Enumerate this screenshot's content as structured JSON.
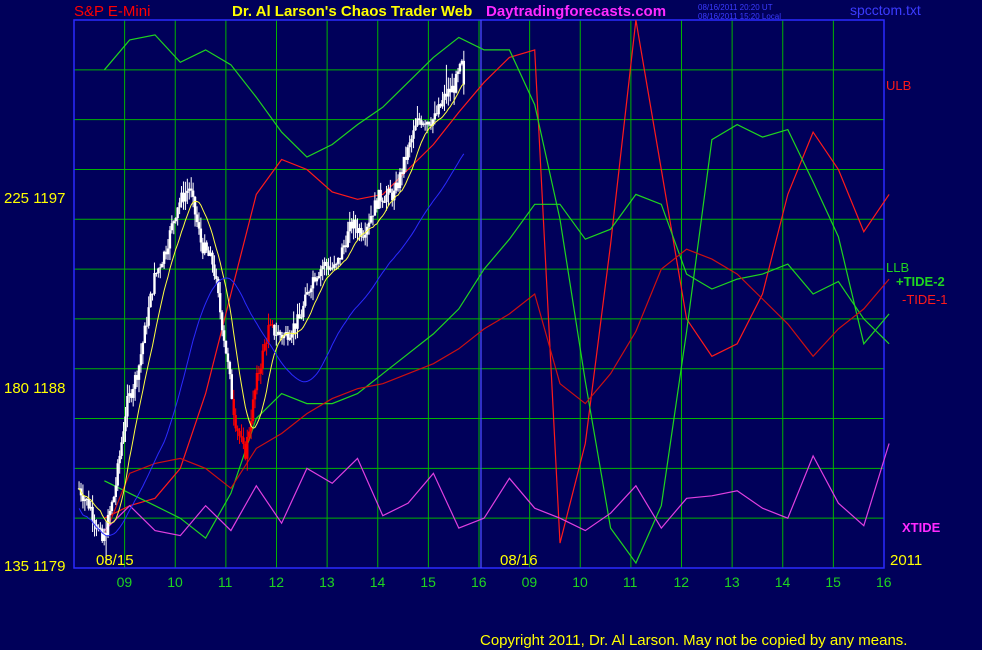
{
  "header": {
    "symbol": "S&P E-Mini",
    "title": "Dr. Al Larson's Chaos Trader Web",
    "site": "Daytradingforecasts.com",
    "stamp_ut": "08/16/2011 20:20 UT",
    "stamp_local": "08/16/2011 15:20 Local",
    "filename": "spcctom.txt"
  },
  "footer": {
    "copyright": "Copyright 2011, Dr. Al Larson. May not be copied by any means."
  },
  "colors": {
    "background": "#00005a",
    "grid": "#00b400",
    "frame": "#2a2aff",
    "price_up": "#ffffff",
    "price_down": "#ff0000",
    "ulb": "#ff1a1a",
    "llb": "#1fd51f",
    "tide_plus2": "#1fd51f",
    "tide_minus1": "#cc1010",
    "xtide": "#e040e0",
    "ma_yellow": "#ffff40",
    "ma_blue": "#2a2aff",
    "yellow_text": "#ffff00",
    "magenta_text": "#ff2aff"
  },
  "chart_data": {
    "type": "line",
    "y_tick_labels": [
      "225 1197",
      "180 1188",
      "135 1179"
    ],
    "x_tick_labels": [
      "09",
      "10",
      "11",
      "12",
      "13",
      "14",
      "15",
      "16",
      "09",
      "10",
      "11",
      "12",
      "13",
      "14",
      "15",
      "16"
    ],
    "date_labels": [
      "08/15",
      "08/16"
    ],
    "year_label": "2011",
    "ylim": [
      1179,
      1201
    ],
    "price_high": 1199.2,
    "price_low": 1179.2,
    "series": [
      {
        "name": "ULB",
        "x": [
          0,
          0.5,
          1,
          1.5,
          2,
          2.5,
          3,
          3.5,
          4,
          4.5,
          5,
          5.5,
          6,
          6.5,
          7,
          7.5,
          8,
          8.5,
          9,
          9.5,
          10,
          10.5,
          11,
          11.5,
          12,
          12.5,
          13,
          13.5,
          14,
          14.5,
          15,
          15.5
        ],
        "y": [
          1181,
          1181.5,
          1181.8,
          1183,
          1186,
          1190,
          1194,
          1195.4,
          1195,
          1194.1,
          1193.8,
          1194,
          1195,
          1196,
          1197.3,
          1198.5,
          1199.5,
          1199.8,
          1180,
          1184,
          1192,
          1201,
          1195,
          1189,
          1187.5,
          1188,
          1190,
          1194,
          1196.5,
          1195,
          1192.5,
          1194
        ]
      },
      {
        "name": "LLB",
        "x": [
          0,
          0.5,
          1,
          1.5,
          2,
          2.5,
          3,
          3.5,
          4,
          4.5,
          5,
          5.5,
          6,
          6.5,
          7,
          7.5,
          8,
          8.5,
          9,
          9.5,
          10,
          10.5,
          11,
          11.5,
          12,
          12.5,
          13,
          13.5,
          14,
          14.5,
          15,
          15.5
        ],
        "y": [
          1182.5,
          1182,
          1181.5,
          1181,
          1180.2,
          1182,
          1185,
          1186,
          1185.6,
          1185.6,
          1186,
          1186.8,
          1187.6,
          1188.4,
          1189.4,
          1191,
          1192.2,
          1193.6,
          1193.6,
          1192.2,
          1192.6,
          1194,
          1193.6,
          1190.8,
          1190.2,
          1190.6,
          1190.8,
          1191.2,
          1190,
          1190.5,
          1189,
          1188
        ]
      },
      {
        "name": "+TIDE-2",
        "x": [
          0,
          0.5,
          1,
          1.5,
          2,
          2.5,
          3,
          3.5,
          4,
          4.5,
          5,
          5.5,
          6,
          6.5,
          7,
          7.5,
          8,
          8.5,
          9,
          9.5,
          10,
          10.5,
          11,
          11.5,
          12,
          12.5,
          13,
          13.5,
          14,
          14.5,
          15,
          15.5
        ],
        "y": [
          1199,
          1200.2,
          1200.4,
          1199.3,
          1199.8,
          1199.2,
          1197.9,
          1196.5,
          1195.5,
          1196,
          1196.8,
          1197.5,
          1198.5,
          1199.5,
          1200.3,
          1199.8,
          1199.8,
          1197.6,
          1193,
          1186.5,
          1180.6,
          1179.2,
          1181.5,
          1188.5,
          1196.2,
          1196.8,
          1196.3,
          1196.6,
          1194.5,
          1192.3,
          1188,
          1189.2
        ]
      },
      {
        "name": "-TIDE-1",
        "x": [
          0,
          0.5,
          1,
          1.5,
          2,
          2.5,
          3,
          3.5,
          4,
          4.5,
          5,
          5.5,
          6,
          6.5,
          7,
          7.5,
          8,
          8.5,
          9,
          9.5,
          10,
          10.5,
          11,
          11.5,
          12,
          12.5,
          13,
          13.5,
          14,
          14.5,
          15,
          15.5
        ],
        "y": [
          1180.3,
          1182.8,
          1183.2,
          1183.4,
          1183,
          1182.2,
          1183.8,
          1184.4,
          1185.2,
          1185.8,
          1186.2,
          1186.4,
          1186.8,
          1187.2,
          1187.8,
          1188.6,
          1189.2,
          1190,
          1186.4,
          1185.6,
          1186.8,
          1188.5,
          1191,
          1191.8,
          1191.4,
          1190.8,
          1189.8,
          1188.8,
          1187.5,
          1188.6,
          1189.4,
          1190.6
        ]
      },
      {
        "name": "XTIDE",
        "x": [
          0,
          0.5,
          1,
          1.5,
          2,
          2.5,
          3,
          3.5,
          4,
          4.5,
          5,
          5.5,
          6,
          6.5,
          7,
          7.5,
          8,
          8.5,
          9,
          9.5,
          10,
          10.5,
          11,
          11.5,
          12,
          12.5,
          13,
          13.5,
          14,
          14.5,
          15,
          15.5
        ],
        "y": [
          1180.5,
          1181.5,
          1180.5,
          1180.3,
          1181.5,
          1180.5,
          1182.3,
          1180.8,
          1183,
          1182.4,
          1183.4,
          1181.1,
          1181.6,
          1182.8,
          1180.6,
          1181,
          1182.6,
          1181.4,
          1181,
          1180.5,
          1181.2,
          1182.3,
          1180.6,
          1181.8,
          1181.9,
          1182.1,
          1181.4,
          1181,
          1183.5,
          1181.6,
          1180.7,
          1184
        ]
      }
    ]
  },
  "line_labels": {
    "ulb": "ULB",
    "llb": "LLB",
    "tide2": "+TIDE-2",
    "tide1": "-TIDE-1",
    "xtide": "XTIDE"
  }
}
